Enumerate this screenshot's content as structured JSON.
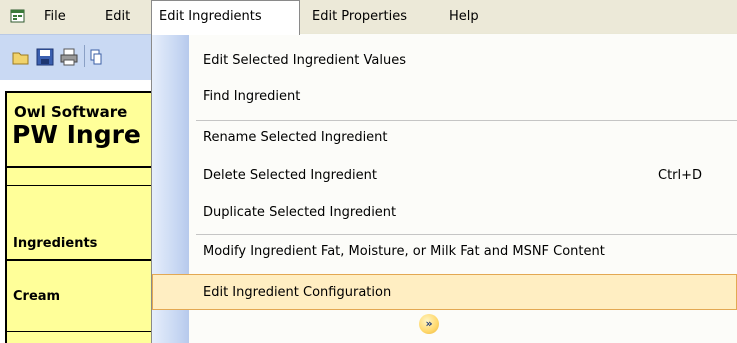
{
  "menubar": {
    "items": [
      {
        "label": "File"
      },
      {
        "label": "Edit"
      },
      {
        "label": "Edit Ingredients"
      },
      {
        "label": "Edit Properties"
      },
      {
        "label": "Help"
      }
    ]
  },
  "sheet": {
    "company": "Owl Software",
    "title": "PW Ingre",
    "column_header": "Ingredients",
    "row_label": "Cream"
  },
  "dropdown": {
    "items": [
      {
        "label": "Edit Selected Ingredient Values",
        "shortcut": ""
      },
      {
        "label": "Find Ingredient",
        "shortcut": ""
      },
      {
        "label": "Rename Selected Ingredient",
        "shortcut": ""
      },
      {
        "label": "Delete Selected Ingredient",
        "shortcut": "Ctrl+D"
      },
      {
        "label": "Duplicate Selected Ingredient",
        "shortcut": ""
      },
      {
        "label": "Modify Ingredient Fat, Moisture, or Milk Fat and MSNF Content",
        "shortcut": ""
      },
      {
        "label": "Edit Ingredient Configuration",
        "shortcut": ""
      }
    ],
    "expand_glyph": "»"
  },
  "colors": {
    "menubar": "#ece9d8",
    "toolbar": "#c9d9f3",
    "panel": "#ffff99",
    "highlight": "#ffeec2",
    "highlight_border": "#e3a853"
  },
  "icons": [
    "app-icon",
    "open-icon",
    "save-icon",
    "print-icon",
    "copy-icon",
    "expand-chevron-icon"
  ]
}
